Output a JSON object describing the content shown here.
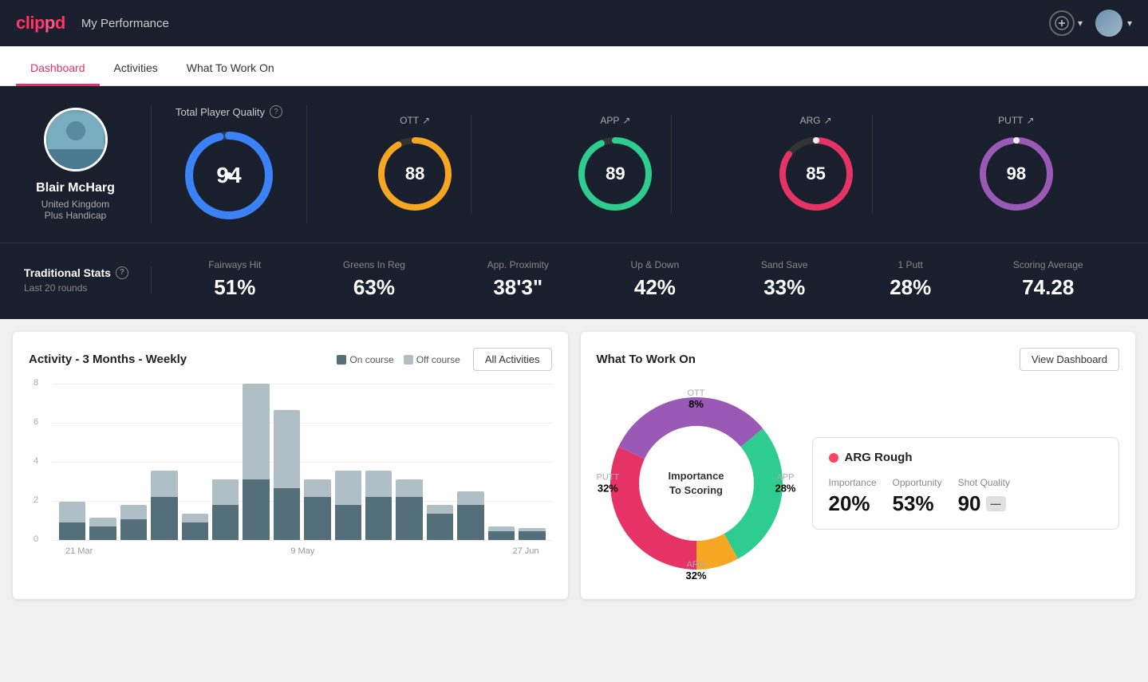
{
  "app": {
    "logo": "clippd",
    "title": "My Performance"
  },
  "header": {
    "add_label": "+",
    "chevron": "▾"
  },
  "nav": {
    "tabs": [
      {
        "id": "dashboard",
        "label": "Dashboard",
        "active": true
      },
      {
        "id": "activities",
        "label": "Activities",
        "active": false
      },
      {
        "id": "what-to-work-on",
        "label": "What To Work On",
        "active": false
      }
    ]
  },
  "player": {
    "name": "Blair McHarg",
    "country": "United Kingdom",
    "handicap": "Plus Handicap"
  },
  "quality": {
    "section_label": "Total Player Quality",
    "main_score": 94,
    "scores": [
      {
        "id": "ott",
        "label": "OTT",
        "value": 88,
        "color": "#f5a623",
        "trail": "#333"
      },
      {
        "id": "app",
        "label": "APP",
        "value": 89,
        "color": "#2ecc8e",
        "trail": "#333"
      },
      {
        "id": "arg",
        "label": "ARG",
        "value": 85,
        "color": "#e63366",
        "trail": "#333"
      },
      {
        "id": "putt",
        "label": "PUTT",
        "value": 98,
        "color": "#9b59b6",
        "trail": "#333"
      }
    ]
  },
  "trad_stats": {
    "title": "Traditional Stats",
    "subtitle": "Last 20 rounds",
    "items": [
      {
        "label": "Fairways Hit",
        "value": "51%"
      },
      {
        "label": "Greens In Reg",
        "value": "63%"
      },
      {
        "label": "App. Proximity",
        "value": "38'3\""
      },
      {
        "label": "Up & Down",
        "value": "42%"
      },
      {
        "label": "Sand Save",
        "value": "33%"
      },
      {
        "label": "1 Putt",
        "value": "28%"
      },
      {
        "label": "Scoring Average",
        "value": "74.28"
      }
    ]
  },
  "activity_chart": {
    "title": "Activity - 3 Months - Weekly",
    "legend": {
      "on_course": "On course",
      "off_course": "Off course"
    },
    "button_label": "All Activities",
    "y_labels": [
      "8",
      "6",
      "4",
      "2",
      "0"
    ],
    "x_labels": [
      "21 Mar",
      "9 May",
      "27 Jun"
    ],
    "bars": [
      {
        "on": 1,
        "off": 1.2
      },
      {
        "on": 0.8,
        "off": 0.5
      },
      {
        "on": 1.2,
        "off": 0.8
      },
      {
        "on": 2.5,
        "off": 1.5
      },
      {
        "on": 1,
        "off": 0.5
      },
      {
        "on": 2,
        "off": 1.5
      },
      {
        "on": 3.5,
        "off": 5.5
      },
      {
        "on": 3,
        "off": 4.5
      },
      {
        "on": 2.5,
        "off": 1
      },
      {
        "on": 2,
        "off": 2
      },
      {
        "on": 2.5,
        "off": 1.5
      },
      {
        "on": 2.5,
        "off": 1
      },
      {
        "on": 1.5,
        "off": 0.5
      },
      {
        "on": 2,
        "off": 0.8
      },
      {
        "on": 0.5,
        "off": 0.3
      },
      {
        "on": 0.5,
        "off": 0.2
      }
    ]
  },
  "work_on": {
    "title": "What To Work On",
    "button_label": "View Dashboard",
    "center_text": "Importance\nTo Scoring",
    "segments": [
      {
        "label": "OTT",
        "value": "8%",
        "color": "#f5a623"
      },
      {
        "label": "APP",
        "value": "28%",
        "color": "#2ecc8e"
      },
      {
        "label": "ARG",
        "value": "32%",
        "color": "#e63366"
      },
      {
        "label": "PUTT",
        "value": "32%",
        "color": "#9b59b6"
      }
    ],
    "highlighted_item": {
      "label": "ARG Rough",
      "dot_color": "#e63366",
      "stats": [
        {
          "label": "Importance",
          "value": "20%"
        },
        {
          "label": "Opportunity",
          "value": "53%"
        },
        {
          "label": "Shot Quality",
          "value": "90"
        }
      ]
    }
  },
  "icons": {
    "info": "?",
    "arrow_up_right": "↗",
    "plus_circle": "⊕",
    "chevron_down": "▾"
  }
}
